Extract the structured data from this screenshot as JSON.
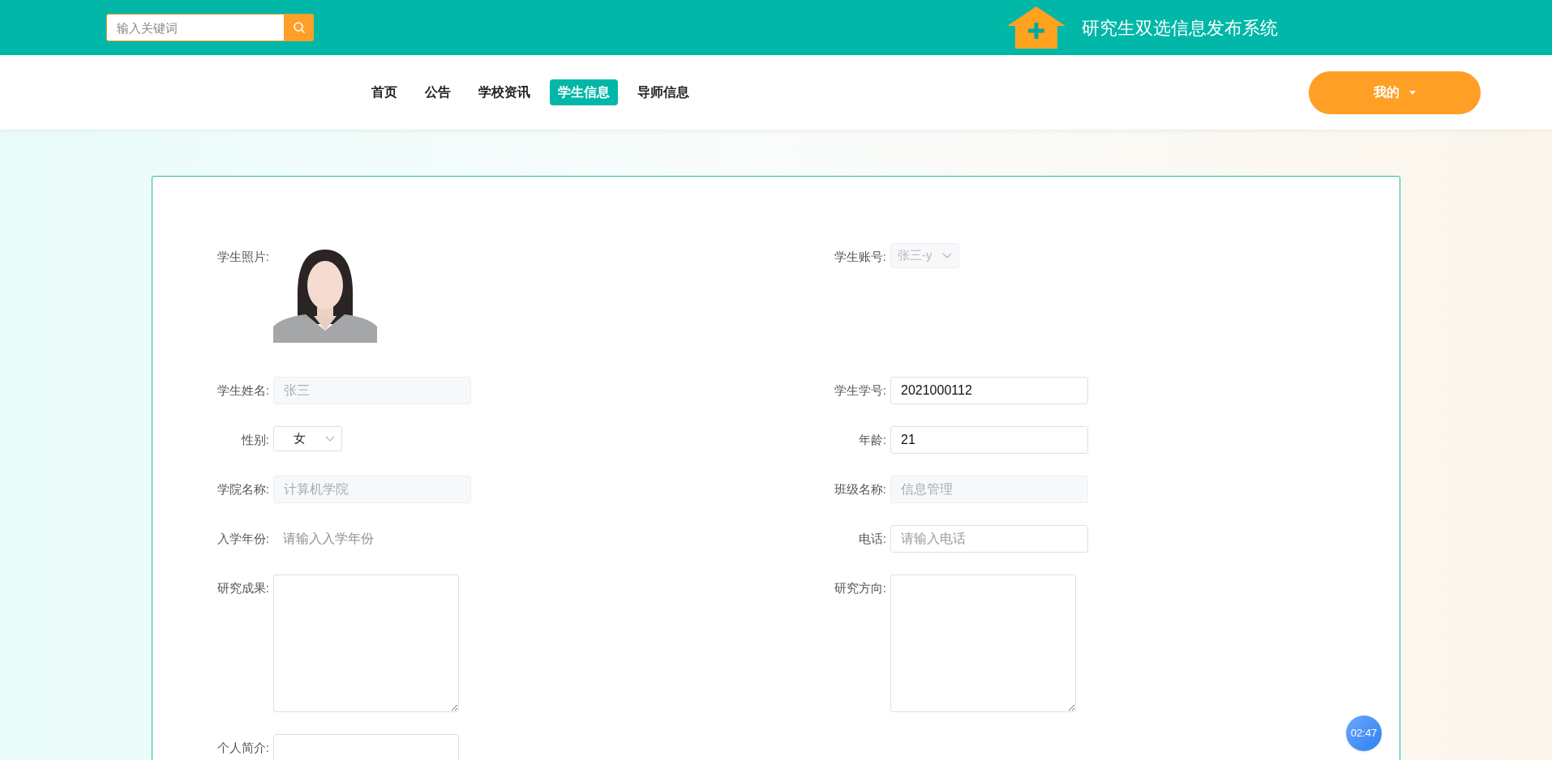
{
  "header": {
    "search": {
      "placeholder": "输入关键词"
    },
    "site_title": "研究生双选信息发布系统"
  },
  "nav": {
    "items": [
      {
        "label": "首页",
        "selected": false
      },
      {
        "label": "公告",
        "selected": false
      },
      {
        "label": "学校资讯",
        "selected": false
      },
      {
        "label": "学生信息",
        "selected": true
      },
      {
        "label": "导师信息",
        "selected": false
      }
    ],
    "user_menu": "我的"
  },
  "form": {
    "rows": [
      {
        "cells": [
          {
            "label": "学生照片:"
          },
          {
            "kind": "select",
            "label": "学生账号:",
            "value": "张三-y",
            "disabled": true
          }
        ]
      },
      {
        "cells": [
          {
            "kind": "input",
            "label": "学生姓名:",
            "value": "张三",
            "disabled": true
          },
          {
            "kind": "input",
            "label": "学生学号:",
            "value": "2021000112",
            "disabled": false
          }
        ]
      },
      {
        "cells": [
          {
            "kind": "select",
            "label": "性别:",
            "value": "女",
            "disabled": false
          },
          {
            "kind": "input",
            "label": "年龄:",
            "value": "21",
            "disabled": false
          }
        ]
      },
      {
        "cells": [
          {
            "kind": "input",
            "label": "学院名称:",
            "value": "计算机学院",
            "disabled": true
          },
          {
            "kind": "input",
            "label": "班级名称:",
            "value": "信息管理",
            "disabled": true
          }
        ]
      },
      {
        "cells": [
          {
            "kind": "plain",
            "label": "入学年份:",
            "placeholder": "请输入入学年份"
          },
          {
            "kind": "input",
            "label": "电话:",
            "placeholder": "请输入电话",
            "disabled": false
          }
        ]
      },
      {
        "cells": [
          {
            "kind": "textarea",
            "label": "研究成果:"
          },
          {
            "kind": "textarea",
            "label": "研究方向:"
          }
        ]
      },
      {
        "cells": [
          {
            "kind": "textarea",
            "label": "个人简介:"
          }
        ]
      }
    ]
  },
  "timer": "02:47"
}
